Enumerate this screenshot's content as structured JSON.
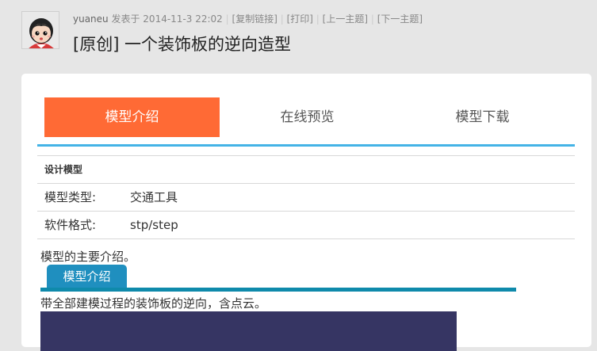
{
  "post": {
    "author": "yuaneu",
    "posted_text": "发表于 2014-11-3 22:02",
    "links": [
      "[复制链接]",
      "[打印]",
      "[上一主题]",
      "[下一主题]"
    ],
    "title": "[原创] 一个装饰板的逆向造型"
  },
  "tabs": [
    {
      "label": "模型介绍",
      "active": true
    },
    {
      "label": "在线预览",
      "active": false
    },
    {
      "label": "模型下载",
      "active": false
    }
  ],
  "info": {
    "heading": "设计模型",
    "rows": [
      {
        "key": "模型类型:",
        "value": "交通工具"
      },
      {
        "key": "软件格式:",
        "value": "stp/step"
      }
    ]
  },
  "content": {
    "intro": "模型的主要介绍。",
    "section_tab": "模型介绍",
    "description": "带全部建模过程的装饰板的逆向，含点云。"
  },
  "colors": {
    "active_tab": "#ff6a35",
    "tab_underline": "#44b3e6",
    "section_tab": "#1f8fbf",
    "section_line": "#0f8aab",
    "image_block": "#363563"
  }
}
